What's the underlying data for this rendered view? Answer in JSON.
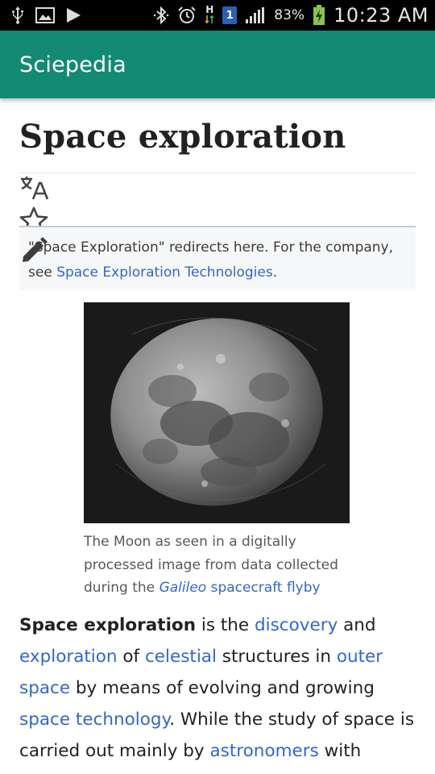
{
  "status_bar": {
    "icons_left": [
      "usb-icon",
      "image-icon",
      "play-icon"
    ],
    "icons_right": [
      "bluetooth-icon",
      "alarm-icon",
      "network-h-icon",
      "sim-icon",
      "signal-icon",
      "battery-icon"
    ],
    "network_label": "H",
    "sim_label": "1",
    "battery_percent": "83%",
    "time": "10:23 AM"
  },
  "app_bar": {
    "title": "Sciepedia",
    "color": "#138a73"
  },
  "article": {
    "title": "Space exploration",
    "action_icons": [
      "translate-icon",
      "star-icon",
      "pencil-icon"
    ],
    "hatnote": {
      "text_before": "\"Space Exploration\" redirects here. For the company, see ",
      "link": "Space Exploration Technologies",
      "text_after": "."
    },
    "figure": {
      "image_alt": "The Moon",
      "caption_before": "The Moon as seen in a digitally processed image from data collected during the ",
      "caption_link_italic": "Galileo",
      "caption_link_rest": " spacecraft flyby"
    },
    "lead": {
      "bold": "Space exploration",
      "t1": " is the ",
      "l1": "discovery",
      "t2": " and ",
      "l2": "exploration",
      "t3": " of ",
      "l3": "celestial",
      "t4": " structures in ",
      "l4": "outer space",
      "t5": " by means of evolving and growing ",
      "l5": "space technology",
      "t6": ". While the study of space is carried out mainly by ",
      "l6": "astronomers",
      "t7": " with"
    },
    "link_color": "#3366cc"
  }
}
